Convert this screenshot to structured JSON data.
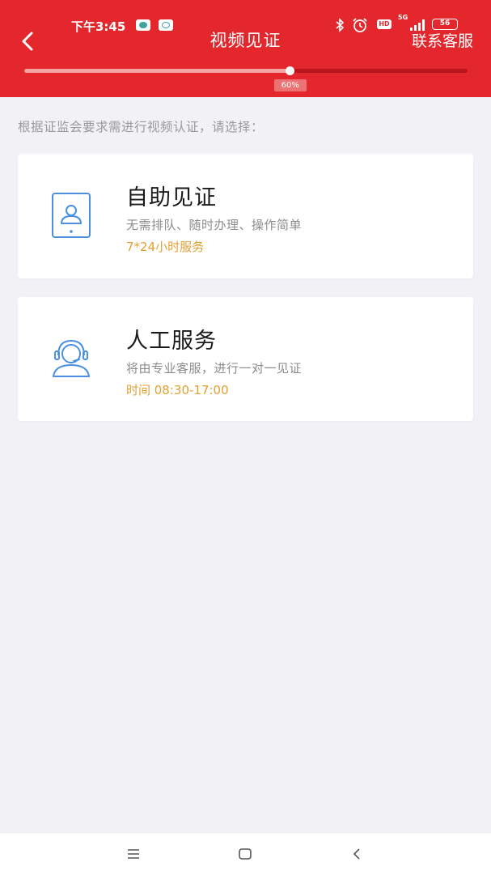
{
  "status_bar": {
    "time": "下午3:45",
    "icons": [
      "app-notification-icon",
      "chat-notification-icon",
      "bluetooth-icon",
      "alarm-icon",
      "hd-icon",
      "signal-5g-icon",
      "battery-icon"
    ],
    "network": "5G",
    "hd_label": "HD",
    "battery": "56"
  },
  "header": {
    "title": "视频见证",
    "contact_label": "联系客服",
    "progress_percent": 60,
    "progress_label": "60%"
  },
  "instruction": "根据证监会要求需进行视频认证，请选择：",
  "options": [
    {
      "icon": "tablet-user-icon",
      "title": "自助见证",
      "description": "无需排队、随时办理、操作简单",
      "hours": "7*24小时服务"
    },
    {
      "icon": "headset-agent-icon",
      "title": "人工服务",
      "description": "将由专业客服，进行一对一见证",
      "hours": "时间 08:30-17:00"
    }
  ],
  "colors": {
    "header_bg": "#e3272d",
    "accent_hours": "#e4a031",
    "icon_blue": "#4a8fe0",
    "page_bg": "#f2f1f6"
  },
  "nav_bar": {
    "buttons": [
      "menu-icon",
      "home-icon",
      "back-icon"
    ]
  }
}
